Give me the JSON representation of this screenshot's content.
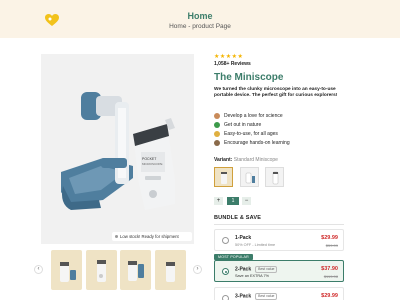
{
  "header": {
    "title": "Home",
    "breadcrumb": "Home - product Page",
    "logo_icon": "heart-logo-icon",
    "background": "#fbf3e6"
  },
  "gallery": {
    "stock_text": "Low stock! Ready for shipment",
    "prev_icon": "chevron-left-icon",
    "next_icon": "chevron-right-icon",
    "thumb_count": 4
  },
  "product": {
    "stars": "★★★★★",
    "reviews": "1,058+ Reviews",
    "title": "The Miniscope",
    "description": "We turned the clunky microscope into an easy-to-use portable device. The perfect gift for curious explorers!",
    "bullets": [
      {
        "text": "Develop a love for science",
        "icon": "kids-icon"
      },
      {
        "text": "Get out in nature",
        "icon": "leaf-icon"
      },
      {
        "text": "Easy-to-use, for all ages",
        "icon": "thumbs-up-icon"
      },
      {
        "text": "Encourage hands-on learning",
        "icon": "hands-icon"
      }
    ],
    "variant_label": "Variant:",
    "variant_value": "Standard Miniscope",
    "quantity": "1",
    "minus": "−",
    "plus": "+"
  },
  "bundle": {
    "heading": "BUNDLE & SAVE",
    "popular_badge": "MOST POPULAR",
    "options": [
      {
        "name": "1-Pack",
        "sub": "50% OFF - Limited time",
        "tag": "",
        "price": "$29.99",
        "old_price": "$59.99",
        "selected": false
      },
      {
        "name": "2-Pack",
        "sub": "Save an EXTRA 7%",
        "tag": "Best value",
        "price": "$37.90",
        "old_price": "$119.98",
        "selected": true
      },
      {
        "name": "3-Pack",
        "sub": "",
        "tag": "Best value",
        "price": "$29.99",
        "old_price": "",
        "selected": false
      }
    ]
  },
  "colors": {
    "brand_green": "#3c7d6a",
    "sale_red": "#d02a2a",
    "star_gold": "#f4b400"
  }
}
